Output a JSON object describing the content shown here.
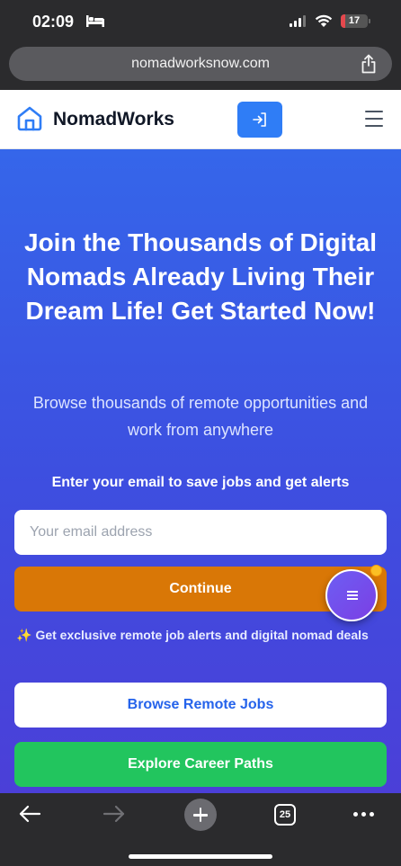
{
  "status_bar": {
    "time": "02:09",
    "battery_percent": 17,
    "battery_color": "#e5484d"
  },
  "browser": {
    "url": "nomadworksnow.com",
    "tab_count": "25"
  },
  "header": {
    "brand": "NomadWorks",
    "accent_color": "#2f7df6"
  },
  "hero": {
    "title": "Join the Thousands of Digital Nomads Already Living Their Dream Life! Get Started Now!",
    "subtitle": "Browse thousands of remote opportunities and work from anywhere",
    "email_label": "Enter your email to save jobs and get alerts",
    "email_placeholder": "Your email address",
    "continue_label": "Continue",
    "alert_note": "Get exclusive remote job alerts and digital nomad deals",
    "browse_label": "Browse Remote Jobs",
    "explore_label": "Explore Career Paths"
  },
  "colors": {
    "continue": "#d97706",
    "explore": "#22c55e",
    "browse_text": "#2563eb"
  },
  "icons": {
    "status": [
      "bed-icon",
      "signal-icon",
      "wifi-icon",
      "battery-icon"
    ],
    "header": [
      "home-logo-icon",
      "login-icon",
      "hamburger-menu-icon"
    ],
    "toolbar": [
      "back-arrow-icon",
      "forward-arrow-icon",
      "new-tab-plus-icon",
      "tabs-icon",
      "more-icon"
    ],
    "hero": [
      "sparkles-icon",
      "chat-menu-icon"
    ]
  }
}
